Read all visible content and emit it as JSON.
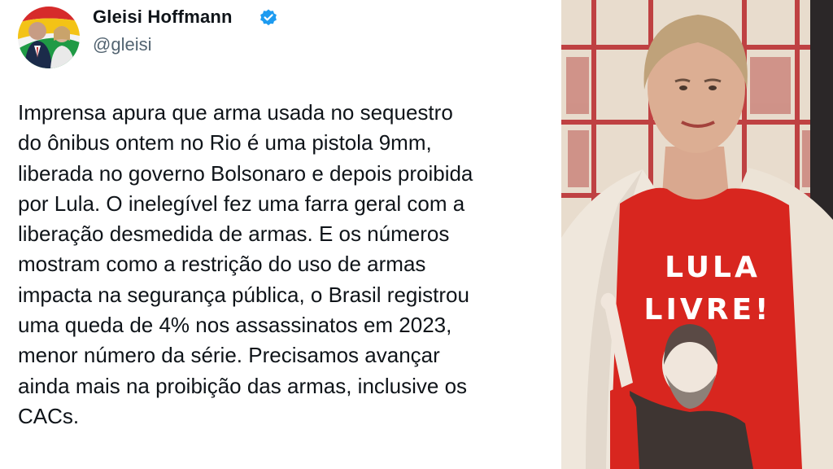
{
  "author": {
    "display_name": "Gleisi Hoffmann",
    "handle": "@gleisi",
    "verified": true,
    "avatar_icon": "profile-avatar-with-flag"
  },
  "tweet": {
    "lines": [
      "Imprensa apura que arma usada no sequestro",
      "do ônibus ontem no Rio é uma pistola 9mm,",
      "liberada no governo Bolsonaro e depois proibida",
      "por Lula. O inelegível fez uma farra geral com a",
      "liberação desmedida de armas. E os números",
      "mostram como a restrição do uso de armas",
      "impacta na segurança pública, o Brasil registrou",
      "uma queda de 4% nos assassinatos em 2023,",
      "menor número da série. Precisamos avançar",
      "ainda mais na proibição das armas, inclusive os",
      "CACs."
    ]
  },
  "photo": {
    "shirt_line_1": "LULA",
    "shirt_line_2": "LIVRE!",
    "colors": {
      "shirt": "#d8261f",
      "jacket": "#efe7dc",
      "background_cloth": "#e8dccd",
      "grid": "#b8262a",
      "verified_blue": "#1d9bf0"
    }
  }
}
